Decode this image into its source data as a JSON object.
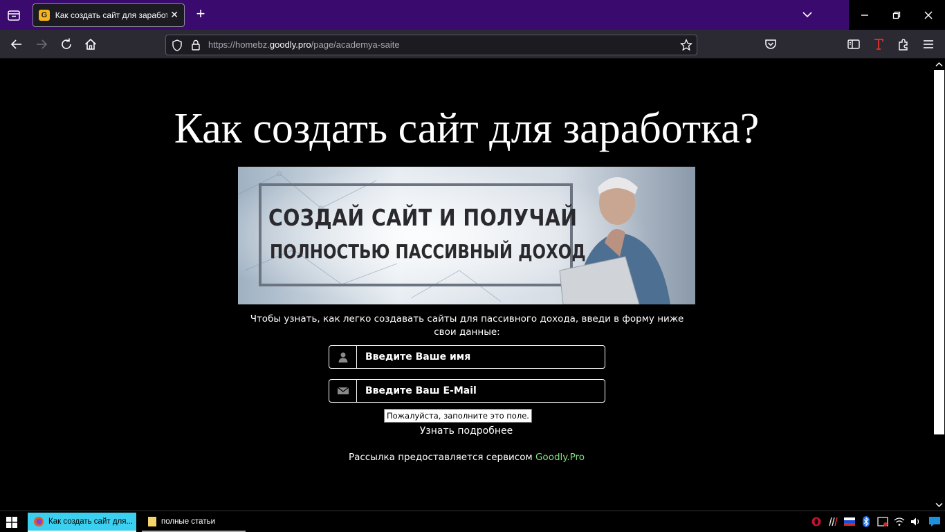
{
  "browser": {
    "tab_title": "Как создать сайт для заработка?",
    "favicon_letter": "G",
    "url_prefix": "https://homebz.",
    "url_domain": "goodly.pro",
    "url_path": "/page/academya-saite"
  },
  "page": {
    "title": "Как создать сайт для заработка?",
    "banner": {
      "line1": "СОЗДАЙ САЙТ И ПОЛУЧАЙ",
      "line2": "ПОЛНОСТЬЮ ПАССИВНЫЙ ДОХОД"
    },
    "intro": "Чтобы узнать, как легко создавать сайты для пассивного дохода, введи в форму ниже свои данные:",
    "name_placeholder": "Введите Ваше имя",
    "email_placeholder": "Введите Ваш E-Mail",
    "validation_tooltip": "Пожалуйста, заполните это поле.",
    "submit_label": "Узнать подробнее",
    "footer_prefix": "Рассылка предоставляется сервисом ",
    "footer_link": "Goodly.Pro"
  },
  "taskbar": {
    "firefox_label": "Как создать сайт для...",
    "folder_label": "полные статьи"
  },
  "colors": {
    "tabbar_bg": "#3b0a6e",
    "link_green": "#7ee27e",
    "taskbar_active": "#3bd0f0"
  }
}
